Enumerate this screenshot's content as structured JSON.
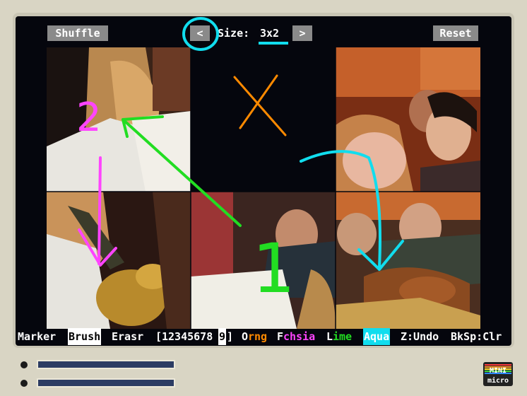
{
  "toolbar": {
    "shuffle_label": "Shuffle",
    "prev_label": "<",
    "size_label": "Size:",
    "size_value": "3x2",
    "next_label": ">",
    "reset_label": "Reset"
  },
  "puzzle": {
    "columns": 3,
    "rows": 2,
    "empty_tile": "row1-col2"
  },
  "annotations": {
    "label_1": "1",
    "label_2": "2"
  },
  "statusbar": {
    "marker": "Marker",
    "brush": "Brush",
    "erasr": "Erasr",
    "sizes_open": "[",
    "sizes_digits": "12345678",
    "sizes_selected": "9",
    "sizes_close": "]",
    "orng_o": "O",
    "orng_rest": "rng",
    "fchsia_f": "F",
    "fchsia_rest": "chsia",
    "lime_l": "L",
    "lime_rest": "ime",
    "aqua": "Aqua",
    "undo": "Z:Undo",
    "clear": "BkSp:Clr"
  },
  "logo": {
    "line1": "MINI",
    "line2": "micro"
  },
  "colors": {
    "orange": "#ff8a00",
    "fuchsia": "#ff44ff",
    "lime": "#22dd22",
    "aqua": "#11ddee",
    "button_gray": "#8a8a8a"
  }
}
